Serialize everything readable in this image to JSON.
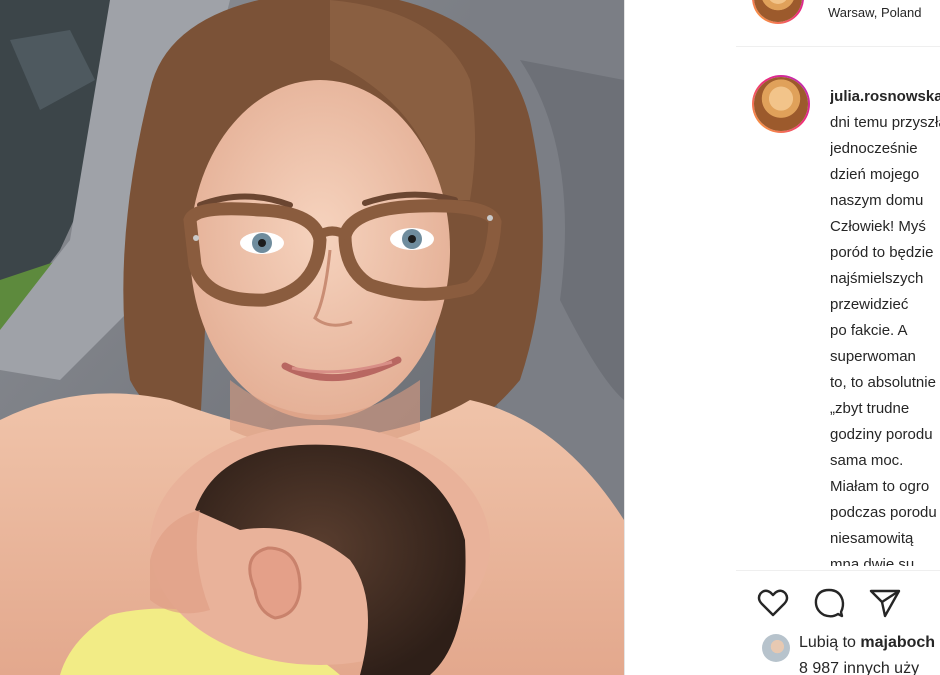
{
  "post": {
    "photo_alt": "Woman with glasses holding newborn baby"
  },
  "header": {
    "location": "Warsaw, Poland"
  },
  "caption": {
    "username": "julia.rosnowska",
    "lines": [
      "dni temu przyszła",
      "jednocześnie",
      "dzień mojego",
      "naszym domu",
      "Człowiek! Myś",
      "poród to będzie",
      "najśmielszych",
      "przewidzieć",
      "po fakcie. A",
      "superwoman",
      "to, to absolutnie",
      "„zbyt trudne",
      "godziny porodu",
      "sama moc.",
      "Miałam to ogro",
      "podczas porodu",
      "niesamowitą",
      "mną dwie su"
    ]
  },
  "actions": {
    "like_icon": "heart-icon",
    "comment_icon": "comment-icon",
    "share_icon": "paper-plane-icon"
  },
  "likes": {
    "prefix": "Lubią to",
    "user": "majaboch",
    "count": "8 987 innych uży"
  }
}
